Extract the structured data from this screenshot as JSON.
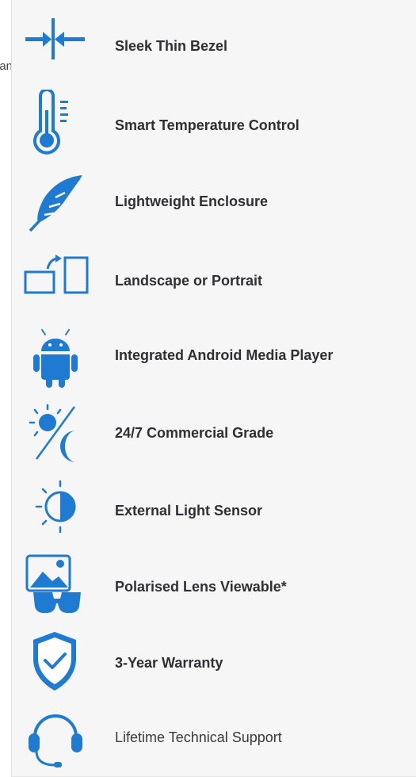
{
  "cut_text": "an",
  "features": [
    {
      "label": "Sleek Thin Bezel",
      "icon": "thin-bezel-icon"
    },
    {
      "label": "Smart Temperature Control",
      "icon": "thermometer-icon"
    },
    {
      "label": "Lightweight Enclosure",
      "icon": "feather-icon"
    },
    {
      "label": "Landscape or Portrait",
      "icon": "rotate-screen-icon"
    },
    {
      "label": "Integrated Android Media Player",
      "icon": "android-icon"
    },
    {
      "label": "24/7 Commercial Grade",
      "icon": "sun-moon-icon"
    },
    {
      "label": "External Light Sensor",
      "icon": "light-sensor-icon"
    },
    {
      "label": "Polarised Lens Viewable*",
      "icon": "polarised-glasses-icon"
    },
    {
      "label": "3-Year Warranty",
      "icon": "shield-check-icon"
    },
    {
      "label": "Lifetime Technical Support",
      "icon": "headset-icon"
    }
  ],
  "colors": {
    "accent": "#1e7bd1",
    "text": "#2f2f34",
    "panel": "#f6f6f6"
  }
}
